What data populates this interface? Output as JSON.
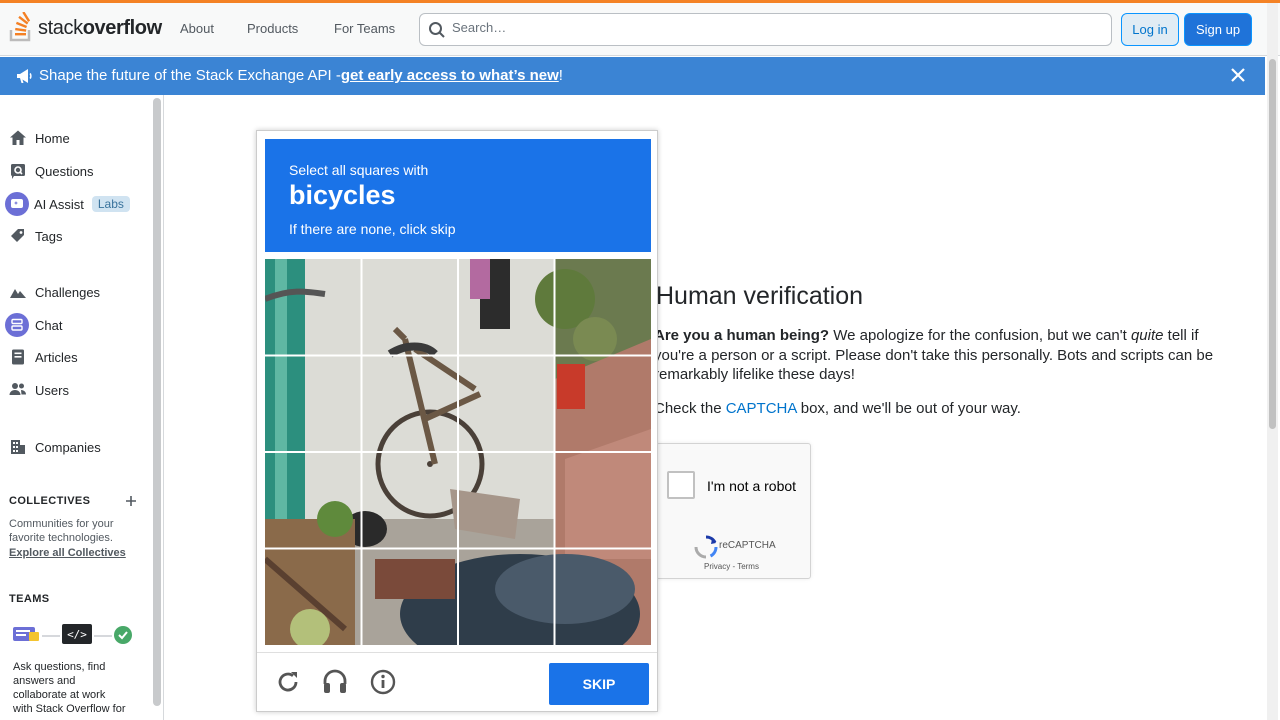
{
  "header": {
    "logo_text_light": "stack",
    "logo_text_bold": "overflow",
    "nav": [
      "About",
      "Products",
      "For Teams"
    ],
    "search_placeholder": "Search…",
    "login_label": "Log in",
    "signup_label": "Sign up"
  },
  "banner": {
    "text": "Shape the future of the Stack Exchange API - ",
    "link_text": "get early access to what’s new",
    "suffix": "!"
  },
  "sidebar": {
    "items": [
      {
        "label": "Home",
        "icon": "home-icon"
      },
      {
        "label": "Questions",
        "icon": "questions-icon"
      },
      {
        "label": "AI Assist",
        "icon": "ai-assist-icon",
        "badge": "Labs"
      },
      {
        "label": "Tags",
        "icon": "tag-icon"
      },
      {
        "label": "Challenges",
        "icon": "challenges-icon"
      },
      {
        "label": "Chat",
        "icon": "chat-icon"
      },
      {
        "label": "Articles",
        "icon": "articles-icon"
      },
      {
        "label": "Users",
        "icon": "users-icon"
      },
      {
        "label": "Companies",
        "icon": "companies-icon"
      }
    ],
    "collectives_heading": "COLLECTIVES",
    "collectives_text_1": "Communities for your",
    "collectives_text_2": "favorite technologies.",
    "collectives_link": "Explore all Collectives",
    "teams_heading": "TEAMS",
    "teams_text": [
      "Ask questions, find",
      "answers and",
      "collaborate at work",
      "with Stack Overflow for"
    ]
  },
  "main": {
    "title": "Human verification",
    "para_bold": "Are you a human being?",
    "para_rest": " We apologize for the confusion, but we can't ",
    "para_italic": "quite",
    "para_rest2": " tell if you're a person or a script. Please don't take this personally. Bots and scripts can be remarkably lifelike these days!",
    "check_prefix": "Check the ",
    "check_link": "CAPTCHA",
    "check_suffix": " box, and we'll be out of your way."
  },
  "recaptcha": {
    "label": "I'm not a robot",
    "brand": "reCAPTCHA",
    "terms": "Privacy - Terms"
  },
  "challenge": {
    "line1": "Select all squares with",
    "target": "bicycles",
    "line3": "If there are none, click skip",
    "skip_label": "SKIP",
    "icons": [
      "reload-icon",
      "audio-icon",
      "info-icon"
    ]
  },
  "colors": {
    "accent_orange": "#f48225",
    "banner_blue": "#3b84d4",
    "captcha_blue": "#1a73e8"
  }
}
